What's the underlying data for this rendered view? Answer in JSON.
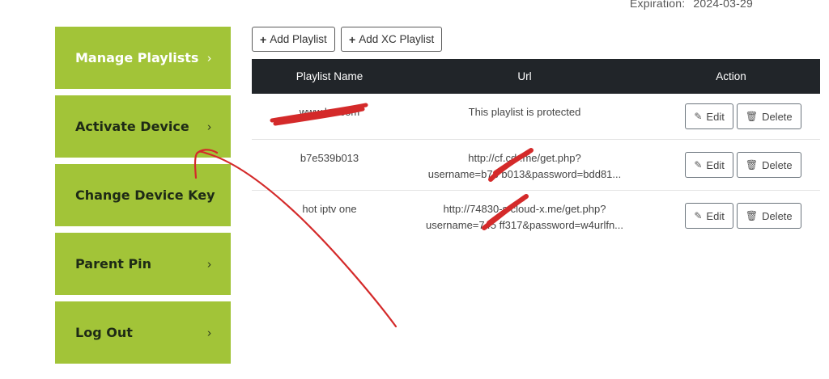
{
  "expiration": {
    "label": "Expiration:",
    "value": "2024-03-29"
  },
  "sidebar": {
    "items": [
      {
        "label": "Manage Playlists",
        "chevron": "›",
        "icon": "chevron-right-icon"
      },
      {
        "label": "Activate Device",
        "chevron": "›",
        "icon": "chevron-right-icon"
      },
      {
        "label": "Change Device Key",
        "chevron": "›",
        "icon": "chevron-right-icon"
      },
      {
        "label": "Parent Pin",
        "chevron": "›",
        "icon": "chevron-right-icon"
      },
      {
        "label": "Log Out",
        "chevron": "›",
        "icon": "chevron-right-icon"
      }
    ]
  },
  "toolbar": {
    "add_playlist": "Add Playlist",
    "add_xc_playlist": "Add XC Playlist",
    "plus_glyph": "+"
  },
  "table": {
    "headers": [
      "Playlist Name",
      "Url",
      "Action"
    ],
    "rows": [
      {
        "name": "www.br       .com",
        "url1": "This playlist is protected",
        "url2": ""
      },
      {
        "name": "b7e539b013",
        "url1": "http://cf.cd    .me/get.php?",
        "url2": "username=b7e    b013&password=bdd81..."
      },
      {
        "name": "hot iptv one",
        "url1": "http://74830-s     cloud-x.me/get.php?",
        "url2": "username=745    ff317&password=w4urlfn..."
      }
    ],
    "edit_label": "Edit",
    "delete_label": "Delete",
    "edit_icon": "edit-icon",
    "delete_icon": "trash-icon"
  },
  "colors": {
    "sidebar_bg": "#a2c438",
    "header_bg": "#212529",
    "annotation": "#d42a2a"
  }
}
